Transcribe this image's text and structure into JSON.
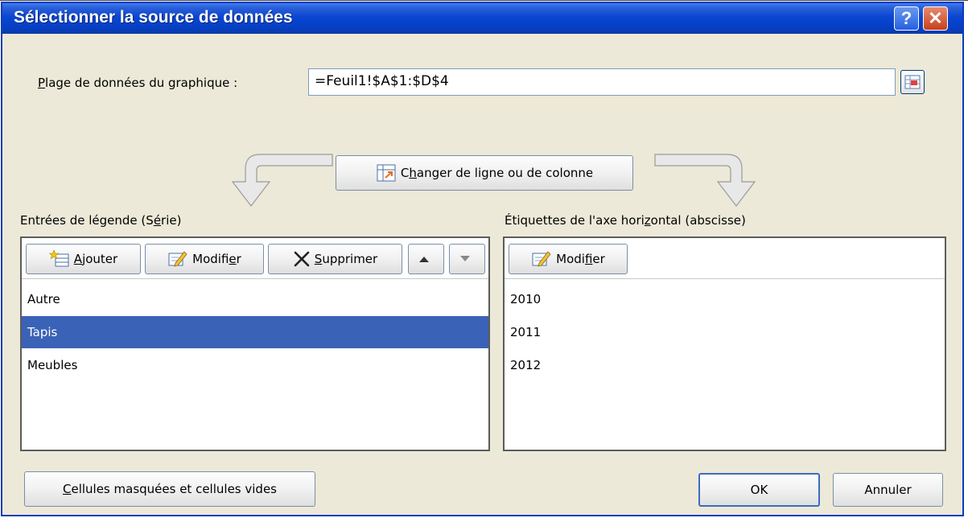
{
  "window": {
    "title": "Sélectionner la source de données",
    "help_glyph": "?",
    "close_glyph": "✕"
  },
  "range": {
    "label_first": "P",
    "label_rest": "lage de données du graphique :",
    "value": "=Feuil1!$A$1:$D$4",
    "picker_icon": "range-select-icon"
  },
  "switch_button": {
    "pre": "C",
    "accel": "h",
    "post": "anger de ligne ou de colonne",
    "icon": "switch-row-column-icon"
  },
  "legend_panel": {
    "header_pre": "Entrées de légende (S",
    "header_accel": "é",
    "header_post": "rie)",
    "add": {
      "accel": "A",
      "rest": "jouter",
      "icon": "add-series-icon"
    },
    "edit": {
      "pre": "Modifi",
      "accel": "e",
      "post": "r",
      "icon": "edit-icon"
    },
    "delete": {
      "accel": "S",
      "rest": "upprimer",
      "icon": "delete-icon"
    },
    "move_up_icon": "arrow-up-icon",
    "move_down_icon": "arrow-down-icon",
    "items": [
      {
        "label": "Autre",
        "selected": false
      },
      {
        "label": "Tapis",
        "selected": true
      },
      {
        "label": "Meubles",
        "selected": false
      }
    ]
  },
  "axis_panel": {
    "header_pre": "Étiquettes de l'axe hori",
    "header_accel": "z",
    "header_post": "ontal (abscisse)",
    "edit": {
      "pre": "Modi",
      "accel": "f",
      "post": "ier",
      "icon": "edit-icon"
    },
    "items": [
      "2010",
      "2011",
      "2012"
    ]
  },
  "footer": {
    "hidden_cells": {
      "accel": "C",
      "rest": "ellules masquées et cellules vides"
    },
    "ok": "OK",
    "cancel": "Annuler"
  },
  "colors": {
    "titlebar": "#0a46d2",
    "dialog_bg": "#ece9d8",
    "selection": "#3a62b6",
    "close_button": "#c6401f"
  }
}
